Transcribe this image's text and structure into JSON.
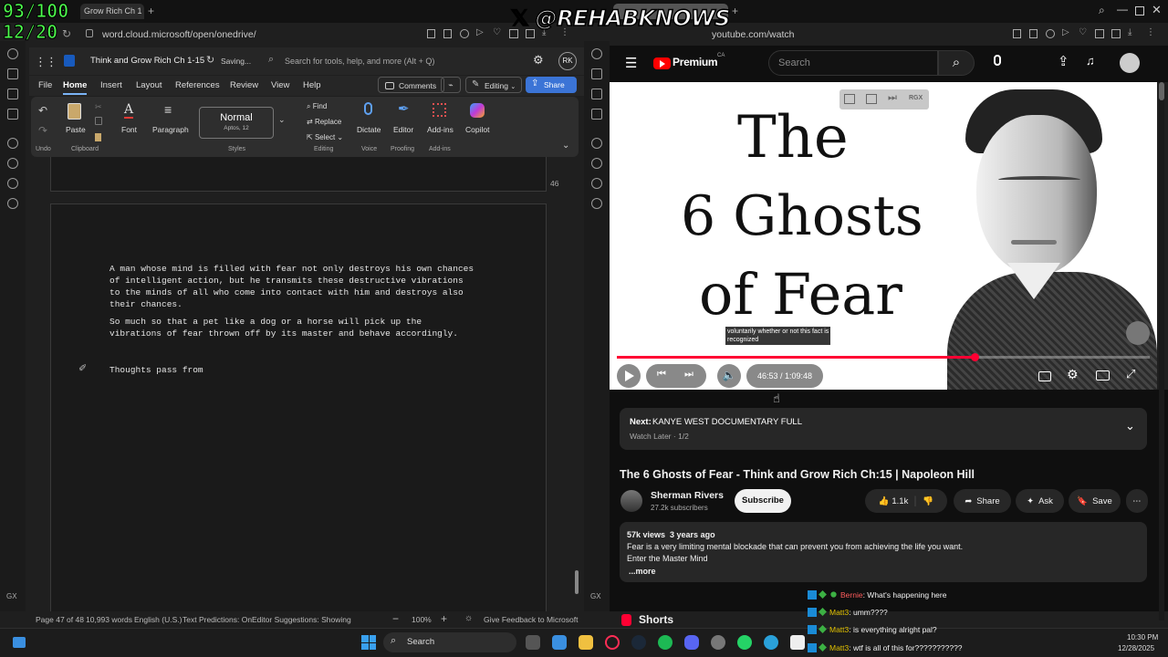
{
  "overlay": {
    "counter1": "93/100",
    "counter2": "12/20",
    "handle": "𝕏 @REHABKNOWS"
  },
  "word": {
    "tab": "Grow Rich Ch 1",
    "url": "word.cloud.microsoft/open/onedrive/",
    "doc_title": "Think and Grow Rich Ch 1-15",
    "saving": "Saving...",
    "search_placeholder": "Search for tools, help, and more (Alt + Q)",
    "avatar": "RK",
    "menus": [
      "File",
      "Home",
      "Insert",
      "Layout",
      "References",
      "Review",
      "View",
      "Help"
    ],
    "comments": "Comments",
    "editing": "Editing",
    "share": "Share",
    "ribbon": {
      "undo": "Undo",
      "paste": "Paste",
      "clipboard": "Clipboard",
      "font": "Font",
      "paragraph": "Paragraph",
      "style_name": "Normal",
      "style_sub": "Aptos, 12",
      "styles": "Styles",
      "find": "Find",
      "replace": "Replace",
      "select": "Select",
      "editing_group": "Editing",
      "dictate": "Dictate",
      "voice": "Voice",
      "editor": "Editor",
      "proofing": "Proofing",
      "addins": "Add-ins",
      "addins_group": "Add-ins",
      "copilot": "Copilot"
    },
    "page_number": "46",
    "paragraph1": "A man whose mind is filled with fear not only destroys his own chances\nof intelligent action, but he transmits these destructive vibrations\nto the minds of all who come into contact with him and destroys also\ntheir chances.",
    "paragraph2": "So much so that a pet like a dog or a horse will pick up the\nvibrations of fear thrown off by its master and behave accordingly.",
    "paragraph3": "Thoughts pass from",
    "status": {
      "page": "Page 47 of 48",
      "words": "10,993 words",
      "lang": "English (U.S.)",
      "predictions": "Text Predictions: On",
      "editor": "Editor Suggestions: Showing",
      "zoom": "100%",
      "feedback": "Give Feedback to Microsoft"
    }
  },
  "yt": {
    "url": "youtube.com/watch",
    "brand": "Premium",
    "region": "CA",
    "search_placeholder": "Search",
    "thumb_line1": "The",
    "thumb_line2": "6 Ghosts",
    "thumb_line3": "of Fear",
    "caption": "voluntarily whether or not this fact is\nrecognized",
    "time": "46:53 / 1:09:48",
    "progress": 0.672,
    "next_label": "Next:",
    "next_title": "KANYE WEST DOCUMENTARY FULL",
    "next_sub": "Watch Later · 1/2",
    "title": "The 6 Ghosts of Fear - Think and Grow Rich Ch:15 | Napoleon Hill",
    "channel": "Sherman Rivers",
    "subs": "27.2k subscribers",
    "subscribe": "Subscribe",
    "likes": "1.1k",
    "share": "Share",
    "ask": "Ask",
    "save": "Save",
    "views": "57k views  3 years ago",
    "desc1": "Fear is a very limiting mental blockade that can prevent you from achieving the life you want.",
    "desc2": "Enter the Master Mind",
    "more": "...more",
    "shorts": "Shorts",
    "chat": [
      {
        "user": "Bernie",
        "msg": ": What's happening here",
        "color": "#ff5c5c"
      },
      {
        "user": "Matt3",
        "msg": ": umm????",
        "color": "#e0c000"
      },
      {
        "user": "Matt3",
        "msg": ": is everything alright pal?",
        "color": "#e0c000"
      },
      {
        "user": "Matt3",
        "msg": ": wtf is all of this for???????????",
        "color": "#e0c000"
      }
    ]
  },
  "taskbar": {
    "search": "Search",
    "time": "10:30 PM",
    "date": "12/28/2025"
  }
}
